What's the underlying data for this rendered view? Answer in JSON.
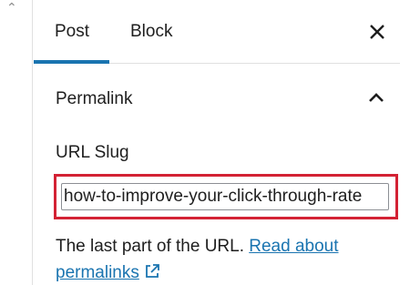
{
  "tabs": {
    "post_label": "Post",
    "block_label": "Block",
    "active": "Post"
  },
  "permalink": {
    "title": "Permalink",
    "url_slug_label": "URL Slug",
    "url_slug_value": "how-to-improve-your-click-through-rate",
    "help_prefix": "The last part of the URL. ",
    "help_link": "Read about permalinks"
  },
  "colors": {
    "accent": "#1a74b0",
    "highlight_border": "#d32234"
  },
  "icons": {
    "close": "close-icon",
    "collapse": "chevron-up-icon",
    "external": "external-link-icon"
  }
}
